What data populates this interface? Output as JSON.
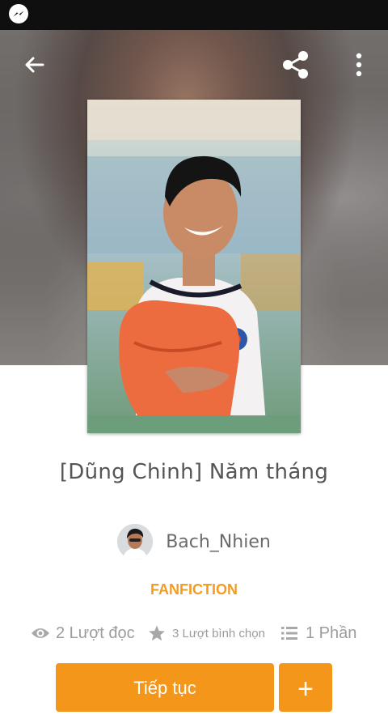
{
  "status_bar": {
    "notification_icon": "messenger-icon"
  },
  "header": {
    "back_icon": "arrow-back-icon",
    "share_icon": "share-icon",
    "more_icon": "more-vertical-icon"
  },
  "story": {
    "title": "[Dũng Chinh] Năm tháng",
    "author": "Bach_Nhien",
    "category": "FANFICTION",
    "stats": {
      "reads": "2 Lượt đọc",
      "votes": "3 Lượt bình chọn",
      "parts": "1 Phần"
    }
  },
  "actions": {
    "continue_label": "Tiếp tục",
    "add_label": "+"
  },
  "colors": {
    "accent": "#f4961a",
    "category": "#f39c1f",
    "status_bar": "#0f0f0f",
    "muted_text": "#9c9c9c"
  }
}
